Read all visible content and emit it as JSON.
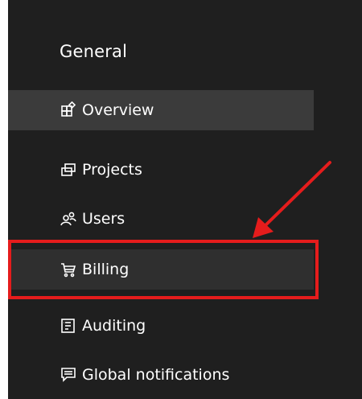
{
  "sidebar": {
    "section_title": "General",
    "items": [
      {
        "label": "Overview",
        "icon": "overview-icon",
        "active": true
      },
      {
        "label": "Projects",
        "icon": "projects-icon"
      },
      {
        "label": "Users",
        "icon": "users-icon"
      },
      {
        "label": "Billing",
        "icon": "cart-icon",
        "highlighted": true
      },
      {
        "label": "Auditing",
        "icon": "auditing-icon"
      },
      {
        "label": "Global notifications",
        "icon": "notification-icon"
      }
    ]
  },
  "colors": {
    "panel_background": "#1f1f1f",
    "active_item_background": "#3b3b3b",
    "accent_bar": "#0f6cbd",
    "annotation_red": "#e51c1c",
    "text": "#ffffff"
  }
}
